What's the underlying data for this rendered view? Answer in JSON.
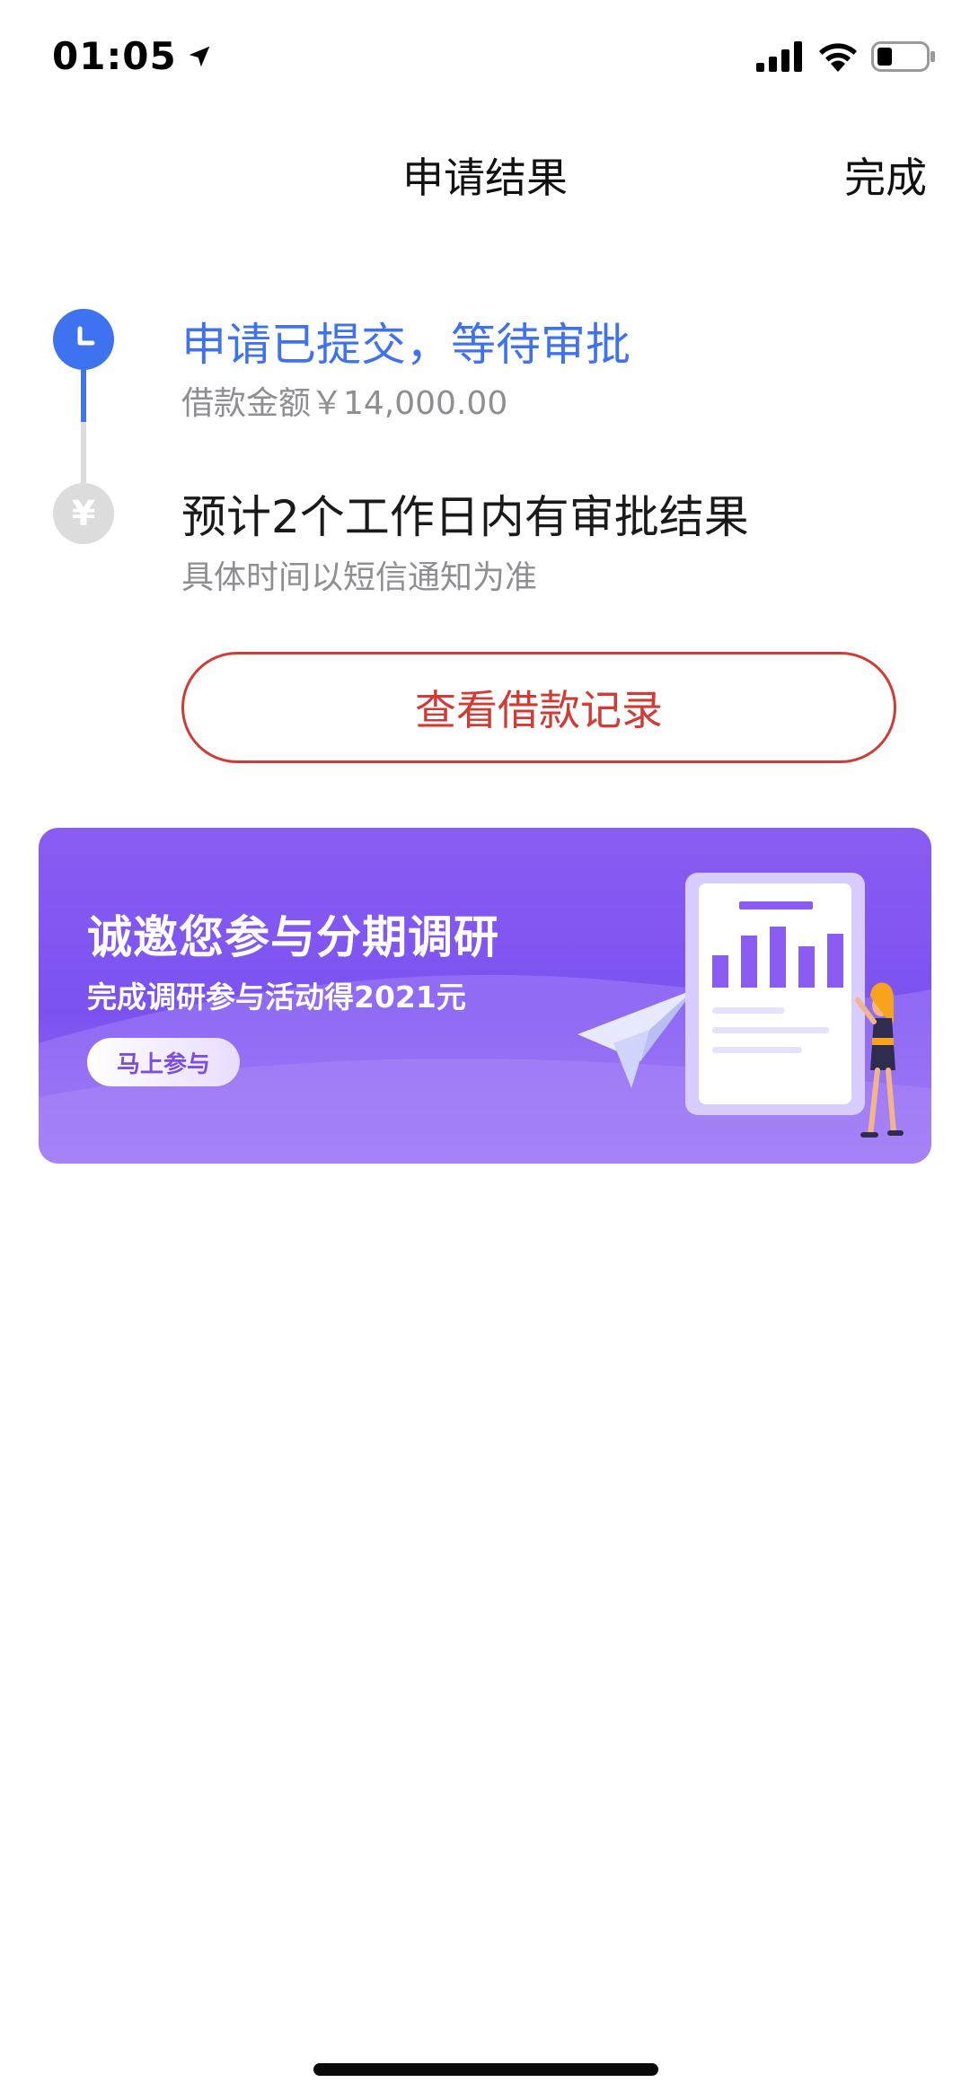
{
  "status_bar": {
    "time": "01:05",
    "icons": [
      "location-arrow-icon",
      "signal-icon",
      "wifi-icon",
      "battery-icon"
    ]
  },
  "nav": {
    "title": "申请结果",
    "done_label": "完成"
  },
  "timeline": {
    "steps": [
      {
        "title": "申请已提交，等待审批",
        "subtitle": "借款金额￥14,000.00",
        "status": "active",
        "icon": "clock-icon"
      },
      {
        "title": "预计2个工作日内有审批结果",
        "subtitle": "具体时间以短信通知为准",
        "status": "pending",
        "icon": "yen-icon",
        "icon_glyph": "¥"
      }
    ]
  },
  "record_button": {
    "label": "查看借款记录"
  },
  "banner": {
    "title": "诚邀您参与分期调研",
    "subtitle": "完成调研参与活动得2021元",
    "cta_label": "马上参与"
  },
  "colors": {
    "accent_blue": "#3f72f0",
    "button_red": "#d13b33",
    "banner_purple": "#7b52f0",
    "muted_grey": "#8e8e93",
    "pending_grey": "#dcdcdc"
  }
}
